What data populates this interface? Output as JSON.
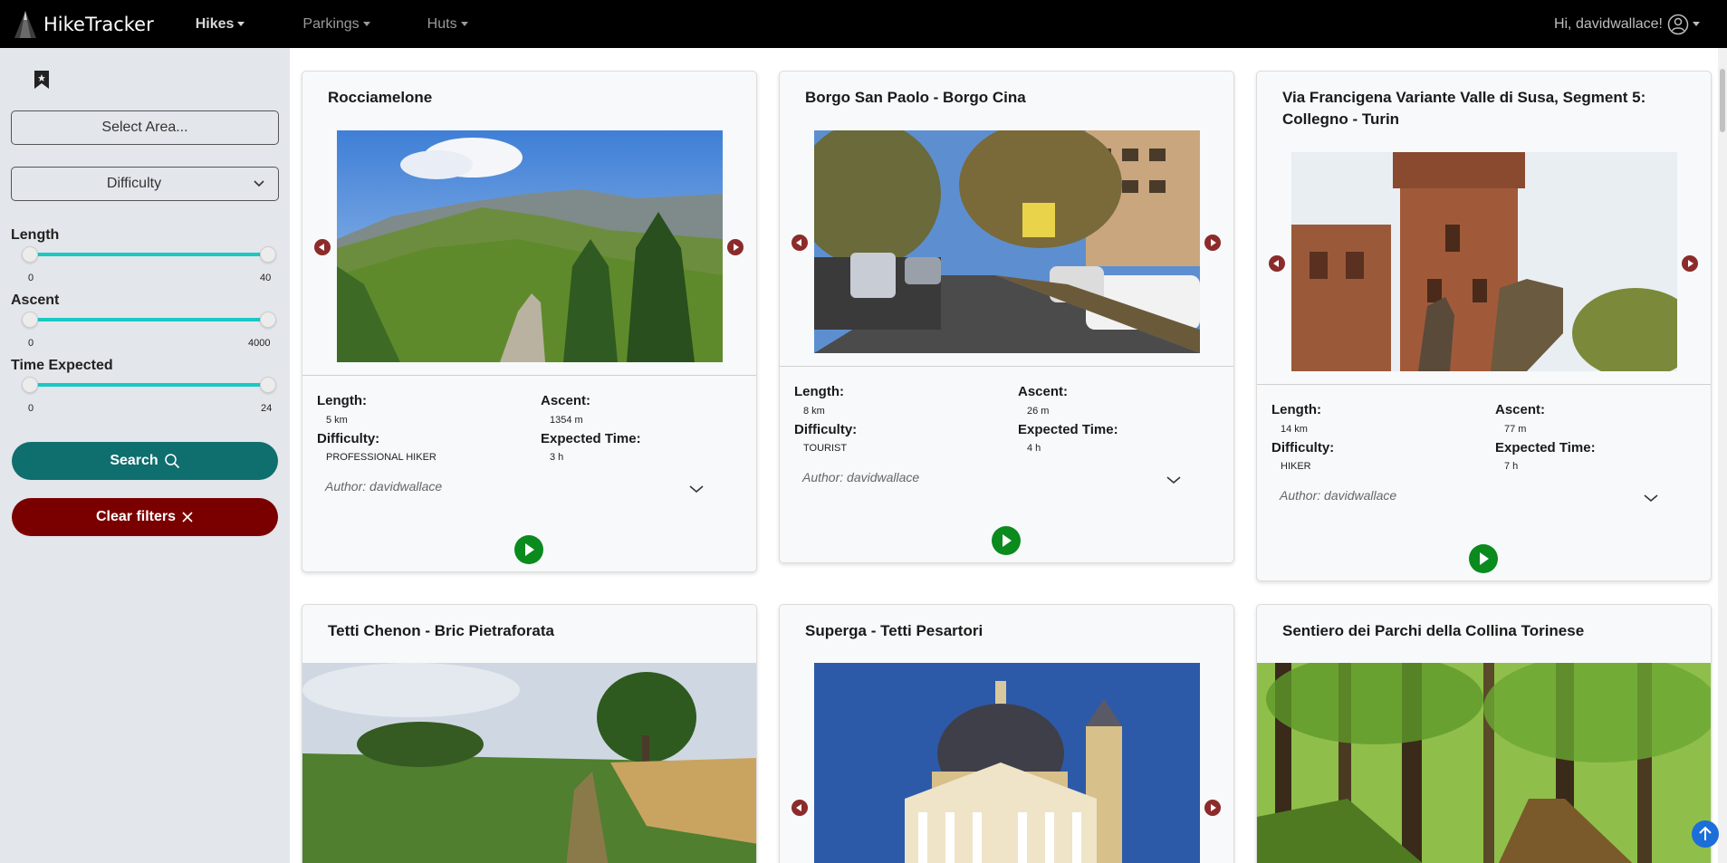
{
  "navbar": {
    "brand": "HikeTracker",
    "menu": [
      {
        "label": "Hikes"
      },
      {
        "label": "Parkings"
      },
      {
        "label": "Huts"
      }
    ],
    "greeting": "Hi, davidwallace!"
  },
  "sidebar": {
    "area_placeholder": "Select Area...",
    "difficulty_label": "Difficulty",
    "filters": [
      {
        "label": "Length",
        "min": "0",
        "max": "40"
      },
      {
        "label": "Ascent",
        "min": "0",
        "max": "4000"
      },
      {
        "label": "Time Expected",
        "min": "0",
        "max": "24"
      }
    ],
    "search_label": "Search",
    "clear_label": "Clear filters"
  },
  "labels": {
    "length": "Length:",
    "ascent": "Ascent:",
    "difficulty": "Difficulty:",
    "expected_time": "Expected Time:"
  },
  "hikes": [
    {
      "title": "Rocciamelone",
      "length": "5 km",
      "ascent": "1354 m",
      "difficulty": "PROFESSIONAL HIKER",
      "time": "3 h",
      "author": "Author: davidwallace"
    },
    {
      "title": "Borgo San Paolo - Borgo Cina",
      "length": "8 km",
      "ascent": "26 m",
      "difficulty": "TOURIST",
      "time": "4 h",
      "author": "Author: davidwallace"
    },
    {
      "title_line1": "Via Francigena Variante Valle di Susa, Segment 5:",
      "title_line2": "Collegno - Turin",
      "length": "14 km",
      "ascent": "77 m",
      "difficulty": "HIKER",
      "time": "7 h",
      "author": "Author: davidwallace"
    },
    {
      "title": "Tetti Chenon - Bric Pietraforata"
    },
    {
      "title": "Superga - Tetti Pesartori"
    },
    {
      "title": "Sentiero dei Parchi della Collina Torinese"
    }
  ],
  "colors": {
    "navbar_bg": "#000000",
    "sidebar_bg": "#e3e6ea",
    "slider_accent": "#1ac8c4",
    "search_btn": "#0f6e6e",
    "clear_btn": "#7a0000",
    "carousel_arrow": "#8b2b2b",
    "play_button": "#0b8a1e",
    "scroll_top_button": "#1c6ed8"
  },
  "icons": {
    "logo": "mountain-logo-icon",
    "user": "user-circle-icon",
    "bookmark": "bookmark-icon",
    "search": "search-icon",
    "clear": "close-icon",
    "carousel_prev": "chevron-left-icon",
    "carousel_next": "chevron-right-icon",
    "expand": "chevron-down-icon",
    "play": "play-icon",
    "scroll_top": "arrow-up-icon"
  }
}
